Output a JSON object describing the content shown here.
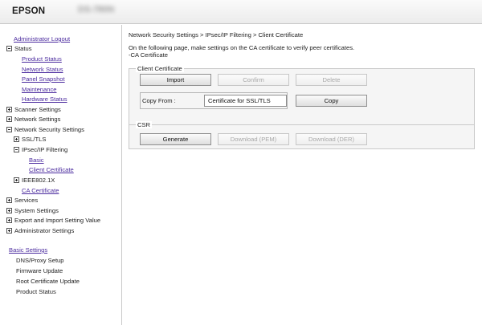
{
  "header": {
    "logo": "EPSON",
    "model": "DS-780N"
  },
  "sidebar": {
    "admin_logout": "Administrator Logout",
    "status": "Status",
    "status_items": [
      "Product Status",
      "Network Status",
      "Panel Snapshot",
      "Maintenance",
      "Hardware Status"
    ],
    "scanner_settings": "Scanner Settings",
    "network_settings": "Network Settings",
    "network_security_settings": "Network Security Settings",
    "ssl_tls": "SSL/TLS",
    "ipsec_ip_filtering": "IPsec/IP Filtering",
    "basic": "Basic",
    "client_certificate": "Client Certificate",
    "ieee8021x": "IEEE802.1X",
    "ca_certificate": "CA Certificate",
    "services": "Services",
    "system_settings": "System Settings",
    "export_import": "Export and Import Setting Value",
    "administrator_settings": "Administrator Settings",
    "basic_settings": "Basic Settings",
    "basic_settings_items": [
      "DNS/Proxy Setup",
      "Firmware Update",
      "Root Certificate Update",
      "Product Status"
    ]
  },
  "main": {
    "breadcrumb": "Network Security Settings > IPsec/IP Filtering > Client Certificate",
    "intro_line1": "On the following page, make settings on the CA certificate to verify peer certificates.",
    "intro_line2": " -CA Certificate",
    "client_certificate": {
      "legend": "Client Certificate",
      "import": "Import",
      "confirm": "Confirm",
      "delete": "Delete",
      "copy_from_label": "Copy From :",
      "copy_from_value": "Certificate for SSL/TLS",
      "copy": "Copy"
    },
    "csr": {
      "legend": "CSR",
      "generate": "Generate",
      "download_pem": "Download (PEM)",
      "download_der": "Download (DER)"
    }
  }
}
